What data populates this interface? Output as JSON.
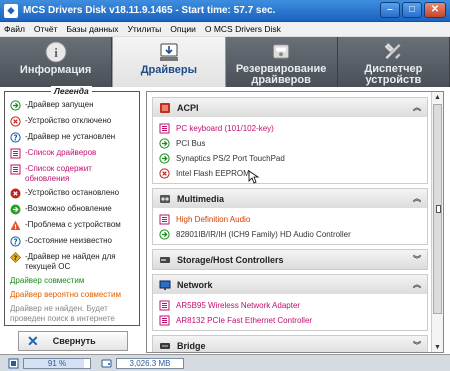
{
  "window": {
    "title": "MCS Drivers Disk v18.11.9.1465 - Start time: 57.7 sec."
  },
  "menu": [
    "Файл",
    "Отчёт",
    "Базы данных",
    "Утилиты",
    "Опции",
    "О MCS Drivers Disk"
  ],
  "tabs": [
    {
      "label": "Информация",
      "icon": "info-icon"
    },
    {
      "label": "Драйверы",
      "icon": "install-icon"
    },
    {
      "label": "Резервирование драйверов",
      "icon": "backup-icon"
    },
    {
      "label": "Диспетчер устройств",
      "icon": "tools-icon"
    }
  ],
  "legend": {
    "title": "Легенда",
    "items": [
      {
        "text": "-Драйвер запущен",
        "icon": "green-arrow-icon",
        "color": "#222222"
      },
      {
        "text": "-Устройство отключено",
        "icon": "red-x-icon",
        "color": "#222222"
      },
      {
        "text": "-Драйвер не установлен",
        "icon": "question-icon",
        "color": "#222222"
      },
      {
        "text": "-Список драйверов",
        "icon": "list-icon",
        "color": "#c01070"
      },
      {
        "text": "-Список содержит обновления",
        "icon": "list-icon",
        "color": "#c01070"
      },
      {
        "text": "-Устройство остановлено",
        "icon": "red-x-filled-icon",
        "color": "#222222"
      },
      {
        "text": "-Возможно обновление",
        "icon": "green-arrow-circle-icon",
        "color": "#222222"
      },
      {
        "text": "-Проблема с устройством",
        "icon": "warning-icon",
        "color": "#222222"
      },
      {
        "text": "-Состояние неизвестно",
        "icon": "question-icon",
        "color": "#222222"
      },
      {
        "text": "-Драйвер не найден для текущей ОС",
        "icon": "diamond-icon",
        "color": "#222222"
      }
    ],
    "note_compatible": "Драйвер совместим",
    "note_probable": "Драйвер вероятно совместим",
    "note_not_found": "Драйвер не найден. Будет проведен поиск в интернете"
  },
  "collapse_button": "Свернуть",
  "sections": [
    {
      "name": "ACPI",
      "icon": "acpi-icon",
      "expanded": true,
      "items": [
        {
          "text": "PC keyboard (101/102-key)",
          "icon": "list-icon",
          "color": "#c01070"
        },
        {
          "text": "PCI Bus",
          "icon": "green-arrow-icon",
          "color": "#333333"
        },
        {
          "text": "Synaptics PS/2 Port TouchPad",
          "icon": "green-arrow-icon",
          "color": "#333333"
        },
        {
          "text": "Intel Flash EEPROM",
          "icon": "red-x-icon",
          "color": "#333333"
        }
      ]
    },
    {
      "name": "Multimedia",
      "icon": "multimedia-icon",
      "expanded": true,
      "items": [
        {
          "text": "High Definition Audio",
          "icon": "list-icon",
          "color": "#d04000"
        },
        {
          "text": "82801IB/IR/IH (ICH9 Family) HD Audio Controller",
          "icon": "green-arrow-icon",
          "color": "#333333"
        }
      ]
    },
    {
      "name": "Storage/Host Controllers",
      "icon": "storage-icon",
      "expanded": false,
      "items": []
    },
    {
      "name": "Network",
      "icon": "network-icon",
      "expanded": true,
      "items": [
        {
          "text": "AR5B95 Wireless Network Adapter",
          "icon": "list-icon",
          "color": "#c01070"
        },
        {
          "text": "AR8132 PCIe Fast Ethernet Controller",
          "icon": "list-icon",
          "color": "#c01070"
        }
      ]
    },
    {
      "name": "Bridge",
      "icon": "bridge-icon",
      "expanded": false,
      "items": []
    }
  ],
  "status": {
    "progress": "91 %",
    "progress_fraction": 0.91,
    "size": "3,026.3 MB"
  },
  "colors": {
    "titlebar": "#1c63c0",
    "compatible": "#1a8a1a",
    "probable": "#e06000",
    "not_found": "#888888"
  }
}
